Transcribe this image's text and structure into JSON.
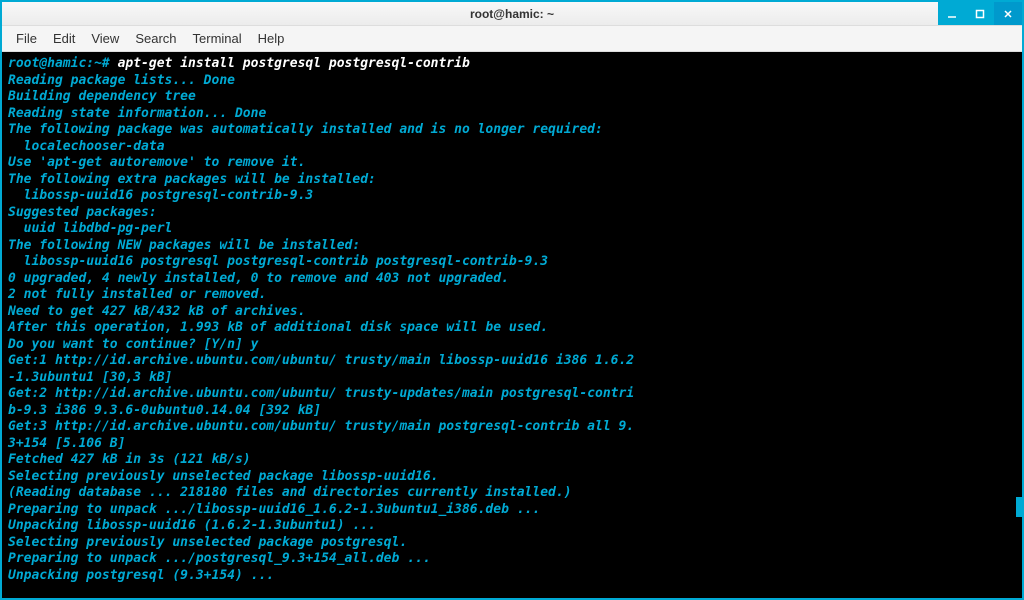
{
  "window": {
    "title": "root@hamic: ~"
  },
  "menubar": {
    "items": [
      "File",
      "Edit",
      "View",
      "Search",
      "Terminal",
      "Help"
    ]
  },
  "terminal": {
    "prompt": "root@hamic:~#",
    "command": " apt-get install postgresql postgresql-contrib",
    "lines": [
      "Reading package lists... Done",
      "Building dependency tree",
      "Reading state information... Done",
      "The following package was automatically installed and is no longer required:",
      "  localechooser-data",
      "Use 'apt-get autoremove' to remove it.",
      "The following extra packages will be installed:",
      "  libossp-uuid16 postgresql-contrib-9.3",
      "Suggested packages:",
      "  uuid libdbd-pg-perl",
      "The following NEW packages will be installed:",
      "  libossp-uuid16 postgresql postgresql-contrib postgresql-contrib-9.3",
      "0 upgraded, 4 newly installed, 0 to remove and 403 not upgraded.",
      "2 not fully installed or removed.",
      "Need to get 427 kB/432 kB of archives.",
      "After this operation, 1.993 kB of additional disk space will be used.",
      "Do you want to continue? [Y/n] y",
      "Get:1 http://id.archive.ubuntu.com/ubuntu/ trusty/main libossp-uuid16 i386 1.6.2",
      "-1.3ubuntu1 [30,3 kB]",
      "Get:2 http://id.archive.ubuntu.com/ubuntu/ trusty-updates/main postgresql-contri",
      "b-9.3 i386 9.3.6-0ubuntu0.14.04 [392 kB]",
      "Get:3 http://id.archive.ubuntu.com/ubuntu/ trusty/main postgresql-contrib all 9.",
      "3+154 [5.106 B]",
      "Fetched 427 kB in 3s (121 kB/s)",
      "Selecting previously unselected package libossp-uuid16.",
      "(Reading database ... 218180 files and directories currently installed.)",
      "Preparing to unpack .../libossp-uuid16_1.6.2-1.3ubuntu1_i386.deb ...",
      "Unpacking libossp-uuid16 (1.6.2-1.3ubuntu1) ...",
      "Selecting previously unselected package postgresql.",
      "Preparing to unpack .../postgresql_9.3+154_all.deb ...",
      "Unpacking postgresql (9.3+154) ..."
    ]
  }
}
